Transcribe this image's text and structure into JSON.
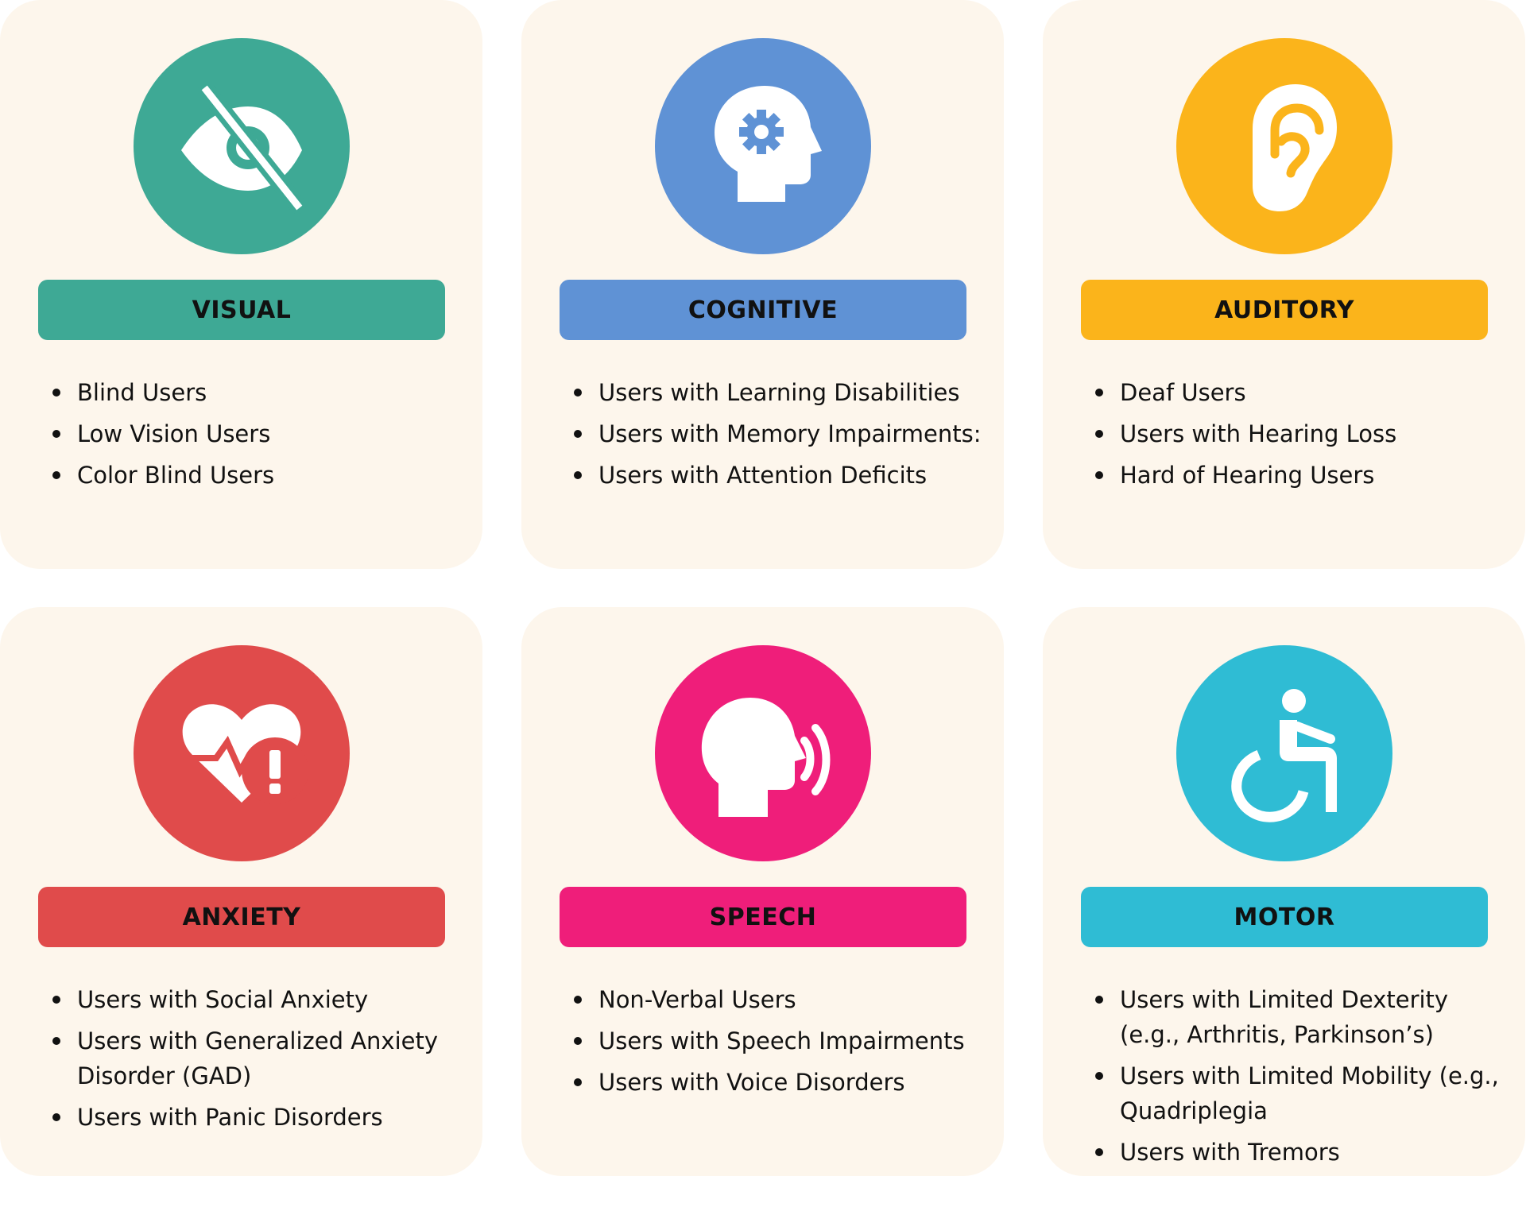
{
  "cards": [
    {
      "title": "VISUAL",
      "color": "#3ea995",
      "icon": "eye-slash-icon",
      "items": [
        "Blind Users",
        "Low Vision Users",
        "Color Blind Users"
      ]
    },
    {
      "title": "COGNITIVE",
      "color": "#5f92d5",
      "icon": "head-gear-icon",
      "items": [
        "Users with Learning Disabilities",
        "Users with Memory Impairments:",
        "Users with Attention Deficits"
      ]
    },
    {
      "title": "AUDITORY",
      "color": "#fbb41b",
      "icon": "ear-icon",
      "items": [
        "Deaf Users",
        "Users with Hearing Loss",
        "Hard of Hearing Users"
      ]
    },
    {
      "title": "ANXIETY",
      "color": "#e04b4b",
      "icon": "heart-alert-icon",
      "items": [
        "Users with Social Anxiety",
        "Users with Generalized Anxiety Disorder (GAD)",
        "Users with Panic Disorders"
      ]
    },
    {
      "title": "SPEECH",
      "color": "#ef1e7a",
      "icon": "speaking-head-icon",
      "items": [
        "Non-Verbal Users",
        "Users with Speech Impairments",
        "Users with Voice Disorders"
      ]
    },
    {
      "title": "MOTOR",
      "color": "#2fbcd4",
      "icon": "wheelchair-icon",
      "items": [
        "Users with Limited Dexterity (e.g., Arthritis, Parkinson’s)",
        "Users with Limited Mobility (e.g., Quadriplegia",
        "Users with Tremors"
      ]
    }
  ]
}
